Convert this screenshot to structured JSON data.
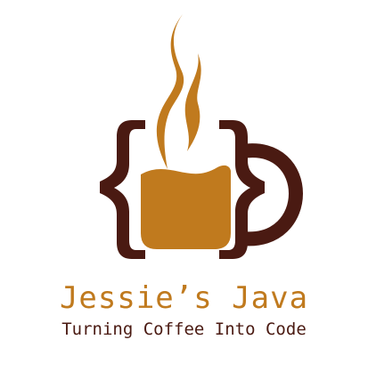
{
  "brand": {
    "name": "Jessie’s Java",
    "tagline": "Turning Coffee Into Code"
  },
  "colors": {
    "coffee": "#c07a1e",
    "cup": "#4a1a12",
    "background": "#ffffff"
  },
  "icons": [
    "steam-icon",
    "curly-brace-icon",
    "coffee-cup-icon"
  ]
}
